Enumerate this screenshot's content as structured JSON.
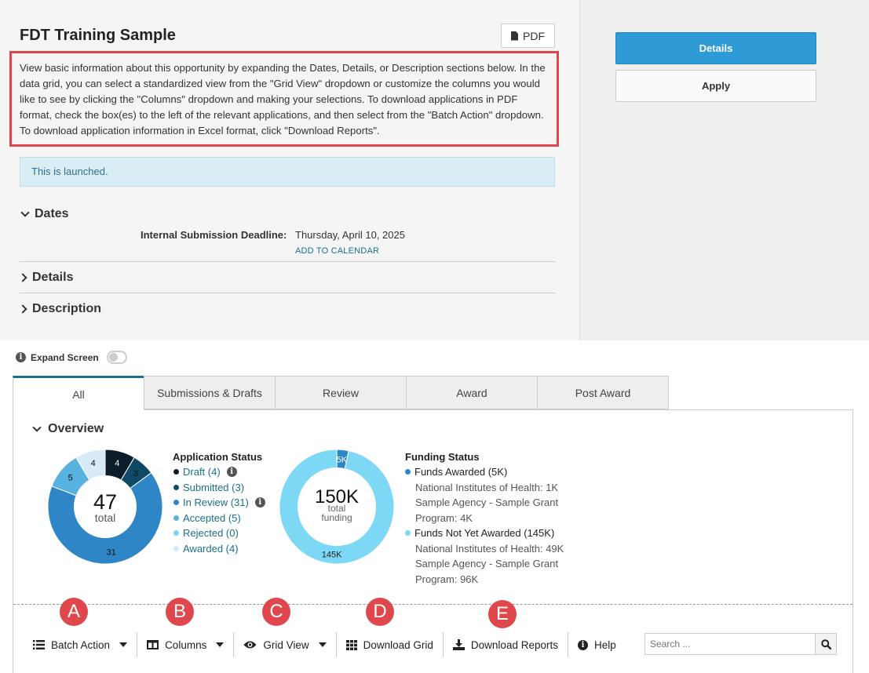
{
  "header": {
    "title": "FDT Training Sample",
    "pdf_label": "PDF",
    "intro": "View basic information about this opportunity by expanding the Dates, Details, or Description sections below. In the data grid, you can select a standardized view from the \"Grid View\" dropdown or customize the columns you would like to see by clicking the \"Columns\" dropdown and making your selections. To download applications in PDF format, check the box(es) to the left of the relevant applications, and then select from the \"Batch Action\" dropdown. To download application information in Excel format, click \"Download Reports\".",
    "alert": "This is launched."
  },
  "sections": {
    "dates": "Dates",
    "details": "Details",
    "description": "Description"
  },
  "dates": {
    "deadline_label": "Internal Submission Deadline:",
    "deadline_value": "Thursday, April 10, 2025",
    "add_to_calendar": "ADD TO CALENDAR"
  },
  "actions": {
    "details": "Details",
    "apply": "Apply"
  },
  "expand_screen": "Expand Screen",
  "tabs": [
    "All",
    "Submissions & Drafts",
    "Review",
    "Award",
    "Post Award"
  ],
  "overview": {
    "title": "Overview",
    "application_status": {
      "title": "Application Status",
      "total": "47",
      "total_label": "total",
      "items": [
        {
          "label": "Draft (4)",
          "value": 4,
          "color": "#0b1d2b",
          "info": true
        },
        {
          "label": "Submitted (3)",
          "value": 3,
          "color": "#0e4a66",
          "info": false
        },
        {
          "label": "In Review (31)",
          "value": 31,
          "color": "#2e86c6",
          "info": true
        },
        {
          "label": "Accepted (5)",
          "value": 5,
          "color": "#58b2e0",
          "info": false
        },
        {
          "label": "Rejected (0)",
          "value": 0,
          "color": "#7fd3f0",
          "info": false
        },
        {
          "label": "Awarded (4)",
          "value": 4,
          "color": "#d7eaf7",
          "info": false
        }
      ],
      "slice_labels": [
        "4",
        "3",
        "31",
        "5",
        "4"
      ]
    },
    "funding_status": {
      "title": "Funding Status",
      "total": "150K",
      "total_label": "total funding",
      "slice_labels": [
        "5K",
        "145K"
      ],
      "awarded": {
        "label": "Funds Awarded (5K)",
        "color": "#2e86c6",
        "value": 5
      },
      "awarded_sub": [
        "National Institutes of Health: 1K",
        "Sample Agency - Sample Grant Program: 4K"
      ],
      "not_awarded": {
        "label": "Funds Not Yet Awarded (145K)",
        "color": "#7dd8f5",
        "value": 145
      },
      "not_awarded_sub": [
        "National Institutes of Health: 49K",
        "Sample Agency - Sample Grant Program: 96K"
      ]
    }
  },
  "toolbar": {
    "batch_action": "Batch Action",
    "columns": "Columns",
    "grid_view": "Grid View",
    "download_grid": "Download Grid",
    "download_reports": "Download Reports",
    "help": "Help",
    "search_placeholder": "Search ..."
  },
  "markers": [
    "A",
    "B",
    "C",
    "D",
    "E"
  ]
}
